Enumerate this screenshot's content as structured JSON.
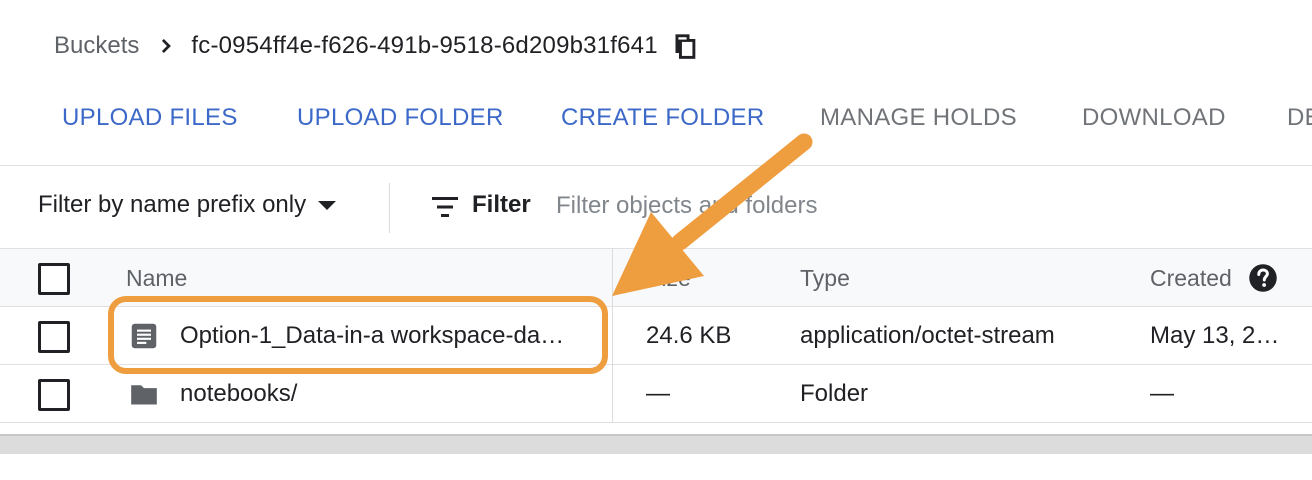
{
  "breadcrumb": {
    "root": "Buckets",
    "current": "fc-0954ff4e-f626-491b-9518-6d209b31f641"
  },
  "toolbar": {
    "upload_files": "UPLOAD FILES",
    "upload_folder": "UPLOAD FOLDER",
    "create_folder": "CREATE FOLDER",
    "manage_holds": "MANAGE HOLDS",
    "download": "DOWNLOAD",
    "delete_partial": "DE"
  },
  "filter": {
    "mode": "Filter by name prefix only",
    "label": "Filter",
    "placeholder": "Filter objects and folders"
  },
  "table": {
    "columns": {
      "name": "Name",
      "size": "Size",
      "type": "Type",
      "created": "Created"
    },
    "rows": [
      {
        "icon": "file-icon",
        "name": "Option-1_Data-in-a workspace-da…",
        "size": "24.6 KB",
        "type": "application/octet-stream",
        "created": "May 13, 2…"
      },
      {
        "icon": "folder-icon",
        "name": "notebooks/",
        "size": "—",
        "type": "Folder",
        "created": "—"
      }
    ]
  },
  "annotation": {
    "color": "#ee9d3f"
  },
  "colors": {
    "accent": "#3c68c8",
    "disabled": "#707478"
  }
}
